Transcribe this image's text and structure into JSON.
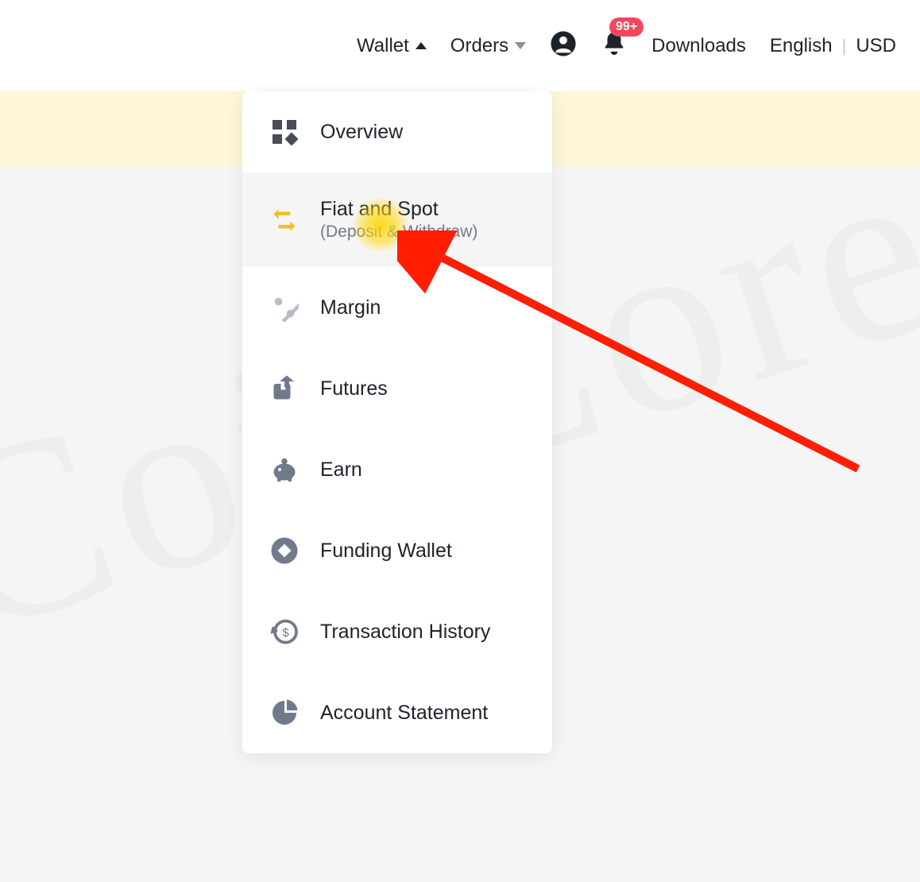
{
  "nav": {
    "wallet": "Wallet",
    "orders": "Orders",
    "downloads": "Downloads",
    "language": "English",
    "currency": "USD",
    "badge": "99+"
  },
  "menu": {
    "items": [
      {
        "label": "Overview",
        "sub": "",
        "icon": "grid"
      },
      {
        "label": "Fiat and Spot",
        "sub": "(Deposit & Withdraw)",
        "icon": "exchange"
      },
      {
        "label": "Margin",
        "sub": "",
        "icon": "percent"
      },
      {
        "label": "Futures",
        "sub": "",
        "icon": "futures"
      },
      {
        "label": "Earn",
        "sub": "",
        "icon": "piggy"
      },
      {
        "label": "Funding Wallet",
        "sub": "",
        "icon": "diamond"
      },
      {
        "label": "Transaction History",
        "sub": "",
        "icon": "history"
      },
      {
        "label": "Account Statement",
        "sub": "",
        "icon": "pie"
      }
    ]
  }
}
